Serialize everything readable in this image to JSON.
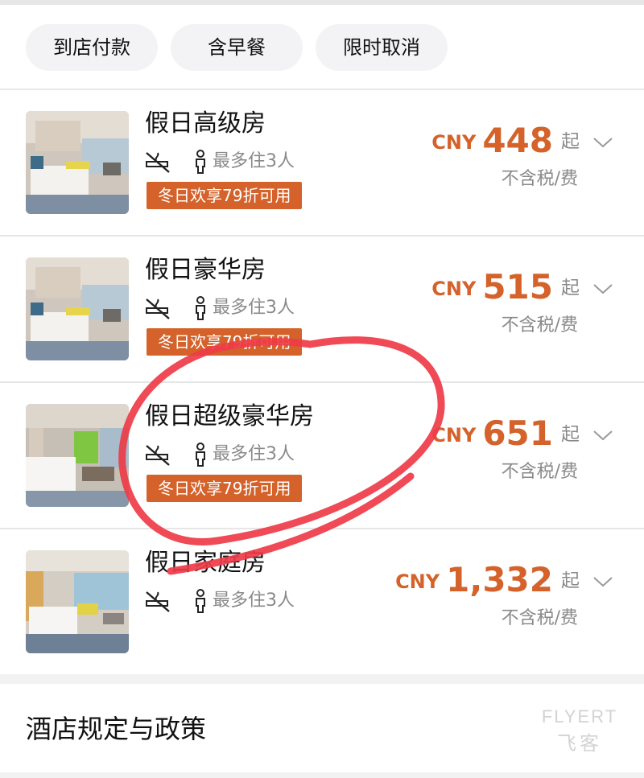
{
  "filters": [
    {
      "label": "到店付款"
    },
    {
      "label": "含早餐"
    },
    {
      "label": "限时取消"
    }
  ],
  "rooms": [
    {
      "name": "假日高级房",
      "occupancy": "最多住3人",
      "promo": "冬日欢享79折可用",
      "currency": "CNY",
      "price": "448",
      "from": "起",
      "tax_note": "不含税/费"
    },
    {
      "name": "假日豪华房",
      "occupancy": "最多住3人",
      "promo": "冬日欢享79折可用",
      "currency": "CNY",
      "price": "515",
      "from": "起",
      "tax_note": "不含税/费"
    },
    {
      "name": "假日超级豪华房",
      "occupancy": "最多住3人",
      "promo": "冬日欢享79折可用",
      "currency": "CNY",
      "price": "651",
      "from": "起",
      "tax_note": "不含税/费"
    },
    {
      "name": "假日家庭房",
      "occupancy": "最多住3人",
      "currency": "CNY",
      "price": "1,332",
      "from": "起",
      "tax_note": "不含税/费"
    }
  ],
  "policy": {
    "title": "酒店规定与政策"
  },
  "watermark": {
    "line1": "FLYERT",
    "line2": "飞客"
  },
  "colors": {
    "accent": "#d4622a",
    "annotation": "#ee3b48",
    "muted": "#8a8a8a"
  },
  "icons": [
    "no-smoking-icon",
    "person-icon",
    "chevron-down-icon"
  ]
}
